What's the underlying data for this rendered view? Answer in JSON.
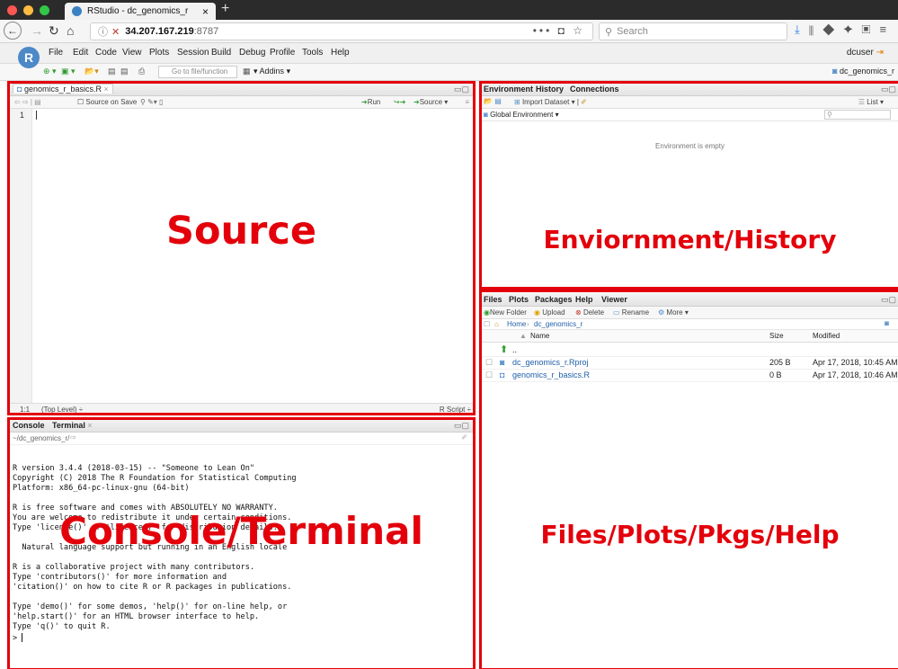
{
  "browser": {
    "tab_title": "RStudio - dc_genomics_r",
    "tab_close": "×",
    "new_tab": "+",
    "url_host": "34.207.167.219",
    "url_port": ":8787",
    "url_more": "•••",
    "search_placeholder": "Search",
    "colors": {
      "close": "#fc5753",
      "minimize": "#fdbc40",
      "maximize": "#33c748"
    }
  },
  "rstudio": {
    "menu": [
      "File",
      "Edit",
      "Code",
      "View",
      "Plots",
      "Session",
      "Build",
      "Debug",
      "Profile",
      "Tools",
      "Help"
    ],
    "user": "dcuser",
    "goto_placeholder": "Go to file/function",
    "addins": "Addins",
    "project": "dc_genomics_r"
  },
  "source": {
    "file_tab": "genomics_r_basics.R",
    "source_on_save": "Source on Save",
    "run": "Run",
    "source_btn": "Source",
    "line_number": "1",
    "cursor_pos": "1:1",
    "scope": "(Top Level)",
    "filetype": "R Script",
    "overlay_label": "Source"
  },
  "environment": {
    "tabs": [
      "Environment",
      "History",
      "Connections"
    ],
    "import_dataset": "Import Dataset",
    "list_btn": "List",
    "scope": "Global Environment",
    "empty_msg": "Environment is empty",
    "overlay_label": "Enviornment/History"
  },
  "files": {
    "tabs": [
      "Files",
      "Plots",
      "Packages",
      "Help",
      "Viewer"
    ],
    "new_folder": "New Folder",
    "upload": "Upload",
    "delete": "Delete",
    "rename": "Rename",
    "more": "More",
    "crumb_home": "Home",
    "crumb_dir": "dc_genomics_r",
    "col_name": "Name",
    "col_size": "Size",
    "col_modified": "Modified",
    "parent": "..",
    "rows": [
      {
        "name": "dc_genomics_r.Rproj",
        "size": "205 B",
        "modified": "Apr 17, 2018, 10:45 AM"
      },
      {
        "name": "genomics_r_basics.R",
        "size": "0 B",
        "modified": "Apr 17, 2018, 10:46 AM"
      }
    ],
    "overlay_label": "Files/Plots/Pkgs/Help"
  },
  "console": {
    "tabs": [
      "Console",
      "Terminal"
    ],
    "path": "~/dc_genomics_r/",
    "lines": [
      "R version 3.4.4 (2018-03-15) -- \"Someone to Lean On\"",
      "Copyright (C) 2018 The R Foundation for Statistical Computing",
      "Platform: x86_64-pc-linux-gnu (64-bit)",
      "",
      "R is free software and comes with ABSOLUTELY NO WARRANTY.",
      "You are welcome to redistribute it under certain conditions.",
      "Type 'license()' or 'licence()' for distribution details.",
      "",
      "  Natural language support but running in an English locale",
      "",
      "R is a collaborative project with many contributors.",
      "Type 'contributors()' for more information and",
      "'citation()' on how to cite R or R packages in publications.",
      "",
      "Type 'demo()' for some demos, 'help()' for on-line help, or",
      "'help.start()' for an HTML browser interface to help.",
      "Type 'q()' to quit R.",
      ""
    ],
    "prompt": ">",
    "overlay_label": "Console/Terminal"
  },
  "colors": {
    "annotation": "#e3000b",
    "rstudio_blue": "#4d88c7"
  }
}
